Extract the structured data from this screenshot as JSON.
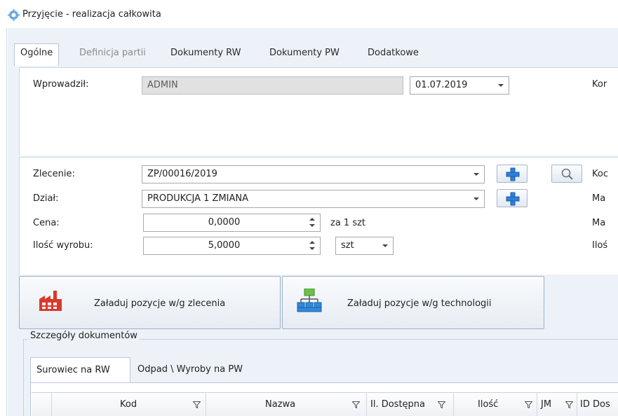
{
  "window": {
    "title": "Przyjęcie - realizacja całkowita"
  },
  "tabs": [
    {
      "label": "Ogólne",
      "state": "active"
    },
    {
      "label": "Definicja partii",
      "state": "disabled"
    },
    {
      "label": "Dokumenty RW",
      "state": "normal"
    },
    {
      "label": "Dokumenty PW",
      "state": "normal"
    },
    {
      "label": "Dodatkowe",
      "state": "normal"
    }
  ],
  "header": {
    "entered_by_label": "Wprowadził:",
    "entered_by_value": "ADMIN",
    "date_value": "01.07.2019",
    "cut_label": "Kor"
  },
  "details": {
    "order_label": "Zlecenie:",
    "order_value": "ZP/00016/2019",
    "department_label": "Dział:",
    "department_value": "PRODUKCJA 1 ZMIANA",
    "price_label": "Cena:",
    "price_value": "0,0000",
    "price_unit_text": "za 1 szt",
    "quantity_label": "Ilość wyrobu:",
    "quantity_value": "5,0000",
    "unit_value": "szt",
    "cut_labels": [
      "Koc",
      "Ma",
      "Ma",
      "Iloś"
    ]
  },
  "actions": {
    "load_by_order": "Załaduj pozycje w/g zlecenia",
    "load_by_technology": "Załaduj pozycje w/g technologii"
  },
  "documents": {
    "group_title": "Szczegóły dokumentów",
    "subtabs": [
      {
        "label": "Surowiec na RW",
        "state": "active"
      },
      {
        "label": "Odpad \\ Wyroby na PW",
        "state": "normal"
      }
    ],
    "columns": [
      "Kod",
      "Nazwa",
      "Il. Dostępna",
      "Ilość",
      "JM",
      "ID Dos"
    ]
  },
  "icons": {
    "app": "gear-icon",
    "add": "plus-icon",
    "search": "magnifier-icon",
    "factory": "factory-icon",
    "hierarchy": "hierarchy-icon",
    "filter": "filter-icon",
    "dropdown": "chevron-down-icon"
  },
  "colors": {
    "plus_blue": "#2f7fd8",
    "factory_red": "#d83a2b",
    "hierarchy_green": "#6cc04a",
    "hierarchy_blue": "#2f8ad8",
    "form_background": "#edf2f8"
  }
}
